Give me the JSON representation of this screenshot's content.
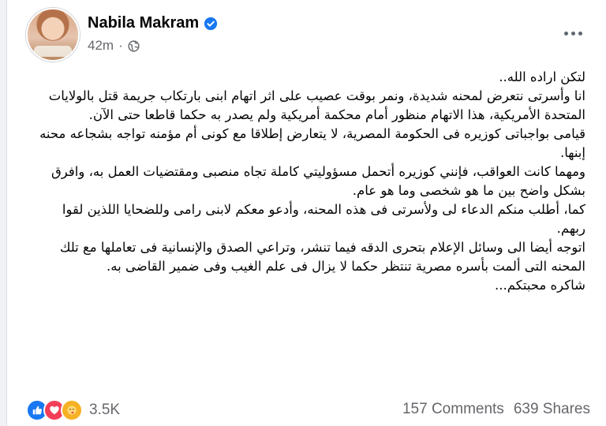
{
  "post": {
    "author": "Nabila Makram",
    "time": "42m",
    "time_separator": "·",
    "paragraphs": [
      "لتكن اراده الله..",
      "انا وأسرتى نتعرض لمحنه شديدة، ونمر بوقت عصيب على اثر اتهام ابنى بارتكاب جريمة قتل بالولايات المتحدة الأمريكية، هذا الاتهام منظور أمام محكمة أمريكية ولم يصدر به حكما قاطعا حتى الآن.",
      "قيامى بواجباتى كوزيره فى الحكومة المصرية، لا يتعارض إطلاقا مع كونى أم مؤمنه تواجه بشجاعه محنه إبنها.",
      "ومهما كانت العواقب، فإنني كوزيره أتحمل مسؤوليتي كاملة تجاه منصبى ومقتضيات العمل به، وافرق بشكل واضح بين ما هو شخصى وما هو عام.",
      "كما، أطلب منكم الدعاء لى ولأسرتى فى هذه المحنه، وأدعو معكم لابنى رامى وللضحايا اللذين لقوا ربهم.",
      "اتوجه أيضا الى وسائل الإعلام بتحرى الدقه فيما تنشر، وتراعي الصدق والإنسانية فى تعاملها مع تلك المحنه التى ألمت بأسره مصرية تنتظر حكما لا يزال فى علم الغيب وفى ضمير القاضى به.",
      "شاكره محبتكم..."
    ],
    "reactions_count": "3.5K",
    "comments": "157 Comments",
    "shares": "639 Shares"
  },
  "icons": {
    "verified": "verified-badge-icon",
    "globe": "globe-icon",
    "more": "more-options-icon",
    "reactions": [
      "like-icon",
      "love-icon",
      "care-icon"
    ]
  },
  "colors": {
    "brand_blue": "#1877f2",
    "love_red": "#f33e58",
    "care_yellow": "#f7b125",
    "secondary_text": "#65676b"
  }
}
